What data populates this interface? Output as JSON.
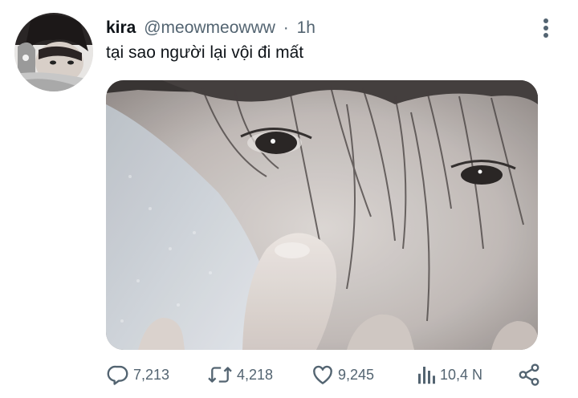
{
  "tweet": {
    "author": {
      "name": "kira",
      "handle": "@meowmeowww",
      "separator": "·",
      "time": "1h"
    },
    "text": "tại sao người lại vội đi mất",
    "actions": {
      "replies": "7,213",
      "retweets": "4,218",
      "likes": "9,245",
      "views": "10,4 N"
    }
  },
  "icons": {
    "more": "more-vertical-icon",
    "reply": "reply-icon",
    "retweet": "retweet-icon",
    "like": "heart-icon",
    "views": "views-chart-icon",
    "share": "share-icon"
  },
  "colors": {
    "text_primary": "#0f1419",
    "text_secondary": "#536471",
    "background": "#ffffff"
  }
}
